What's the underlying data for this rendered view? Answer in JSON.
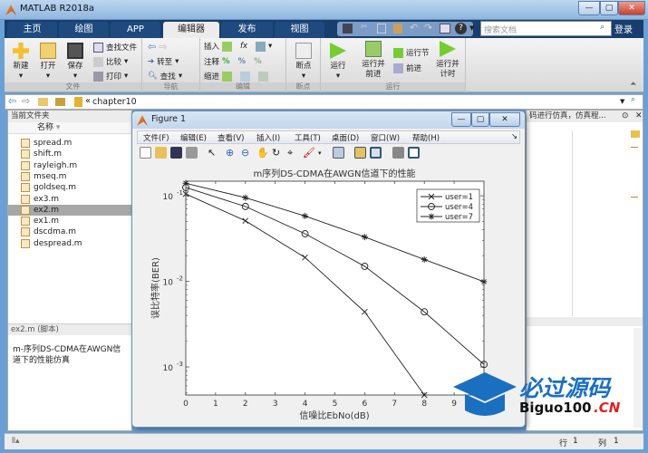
{
  "window": {
    "title": "MATLAB R2018a",
    "minimize": "—",
    "maximize": "▢",
    "close": "✕"
  },
  "tabs": [
    {
      "label": "主页"
    },
    {
      "label": "绘图"
    },
    {
      "label": "APP"
    },
    {
      "label": "编辑器",
      "active": true
    },
    {
      "label": "发布"
    },
    {
      "label": "视图"
    }
  ],
  "search": {
    "placeholder": "搜索文档"
  },
  "login": "登录",
  "ribbon": {
    "file_group": {
      "label": "文件",
      "new": "新建",
      "open": "打开",
      "save": "保存",
      "find_files": "查找文件",
      "compare": "比较",
      "print": "打印"
    },
    "nav_group": {
      "label": "导航",
      "goto": "转至",
      "find": "查找"
    },
    "edit_group": {
      "label": "编辑",
      "insert": "插入",
      "comment": "注释",
      "indent": "缩进"
    },
    "bp_group": {
      "label": "断点",
      "breakpoints": "断点"
    },
    "run_group": {
      "label": "运行",
      "run": "运行",
      "run_advance": "运行并\n前进",
      "run_section": "运行节",
      "advance": "前进",
      "run_time": "运行并\n计时"
    }
  },
  "address": {
    "path": "chapter10",
    "sep": "«"
  },
  "current_folder": {
    "title": "当前文件夹",
    "column": "名称",
    "files": [
      "spread.m",
      "shift.m",
      "rayleigh.m",
      "mseq.m",
      "goldseq.m",
      "ex3.m",
      "ex2.m",
      "ex1.m",
      "dscdma.m",
      "despread.m"
    ],
    "selected": "ex2.m"
  },
  "details": {
    "title": "ex2.m  (脚本)",
    "description": "m-序列DS-CDMA在AWGN信道下的性能仿真"
  },
  "editor_header": "码进行仿真，仿真程...",
  "status": {
    "row_label": "行",
    "row": "1",
    "col_label": "列",
    "col": "1"
  },
  "figure": {
    "title": "Figure 1",
    "menu": [
      "文件(F)",
      "编辑(E)",
      "查看(V)",
      "插入(I)",
      "工具(T)",
      "桌面(D)",
      "窗口(W)",
      "帮助(H)"
    ]
  },
  "watermark": {
    "line1": "必过源码",
    "line2": "Biguo100",
    "line3": ".CN"
  },
  "chart_data": {
    "type": "line",
    "title": "m序列DS-CDMA在AWGN信道下的性能",
    "xlabel": "信噪比EbNo(dB)",
    "ylabel": "误比特率(BER)",
    "xlim": [
      0,
      10
    ],
    "ylim": [
      0.00047,
      0.148
    ],
    "yscale": "log",
    "xticks": [
      "0",
      "1",
      "2",
      "3",
      "4",
      "5",
      "6",
      "7",
      "8",
      "9"
    ],
    "yticks": [
      {
        "value": 0.1,
        "label": "10",
        "exp": "-1"
      },
      {
        "value": 0.01,
        "label": "10",
        "exp": "-2"
      },
      {
        "value": 0.001,
        "label": "10",
        "exp": "-3"
      }
    ],
    "legend_position": "top-right",
    "grid": false,
    "series": [
      {
        "name": "user=1",
        "marker": "x",
        "x": [
          0,
          2,
          4,
          6,
          8
        ],
        "y": [
          0.105,
          0.051,
          0.019,
          0.0044,
          0.00046
        ]
      },
      {
        "name": "user=4",
        "marker": "o",
        "x": [
          0,
          2,
          4,
          6,
          8,
          10
        ],
        "y": [
          0.125,
          0.075,
          0.036,
          0.015,
          0.0044,
          0.00107
        ]
      },
      {
        "name": "user=7",
        "marker": "*",
        "x": [
          0,
          2,
          4,
          6,
          8,
          10
        ],
        "y": [
          0.14,
          0.095,
          0.058,
          0.033,
          0.018,
          0.0099
        ]
      }
    ]
  }
}
